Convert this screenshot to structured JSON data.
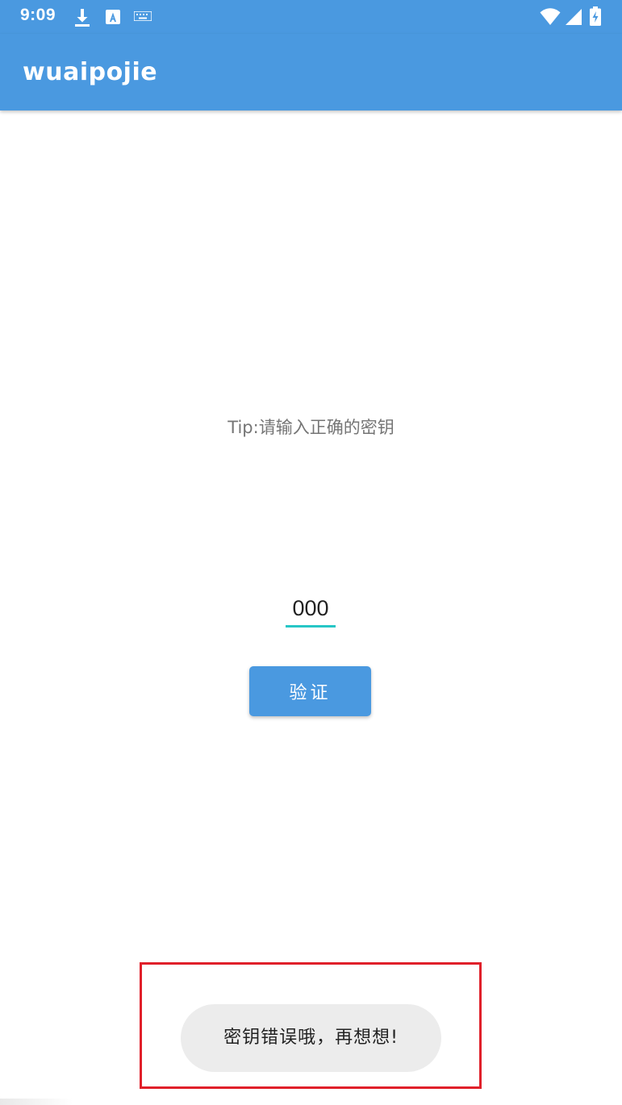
{
  "status_bar": {
    "time": "9:09",
    "icons": {
      "download": "download-icon",
      "autofill": "autofill-a-icon",
      "keyboard": "keyboard-icon",
      "wifi": "wifi-icon",
      "signal": "cell-signal-icon",
      "battery": "battery-charging-icon"
    },
    "background": "#4a99e0"
  },
  "app_bar": {
    "title": "wuaipojie",
    "background": "#4a99e0"
  },
  "main": {
    "tip": "Tip:请输入正确的密钥",
    "key_input": {
      "value": "000",
      "underline_color": "#26c6c6"
    },
    "verify_button": {
      "label": "验证",
      "background": "#4a99e0"
    }
  },
  "toast": {
    "message": "密钥错误哦，再想想!",
    "highlight_color": "#e0202a"
  }
}
